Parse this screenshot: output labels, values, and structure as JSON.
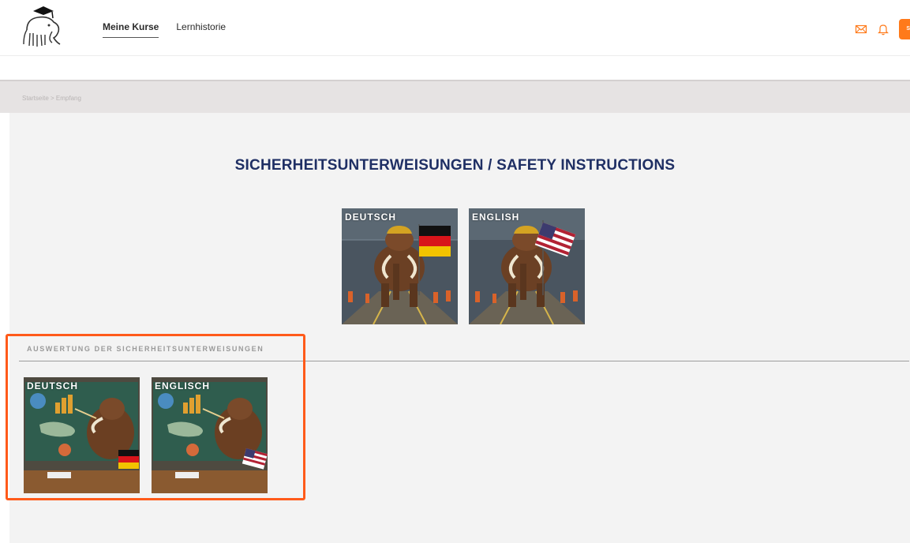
{
  "header": {
    "nav": [
      {
        "label": "Meine Kurse",
        "active": true
      },
      {
        "label": "Lernhistorie",
        "active": false
      }
    ],
    "icons": [
      "mail-icon",
      "bell-icon"
    ],
    "user_badge": "S",
    "accent_color": "#ff7a1a"
  },
  "breadcrumb": "Startseite > Empfang",
  "main": {
    "title": "SICHERHEITSUNTERWEISUNGEN / SAFETY INSTRUCTIONS",
    "courses": [
      {
        "label": "DEUTSCH",
        "flag": "germany"
      },
      {
        "label": "ENGLISH",
        "flag": "usa"
      }
    ],
    "evaluation": {
      "title": "AUSWERTUNG DER SICHERHEITSUNTERWEISUNGEN",
      "items": [
        {
          "label": "DEUTSCH",
          "flag": "germany"
        },
        {
          "label": "ENGLISCH",
          "flag": "usa"
        }
      ]
    }
  },
  "colors": {
    "title": "#1f2f64",
    "highlight": "#ff5a1a",
    "breadcrumb_bar": "#e6e3e3",
    "content_bg": "#f3f3f3"
  }
}
